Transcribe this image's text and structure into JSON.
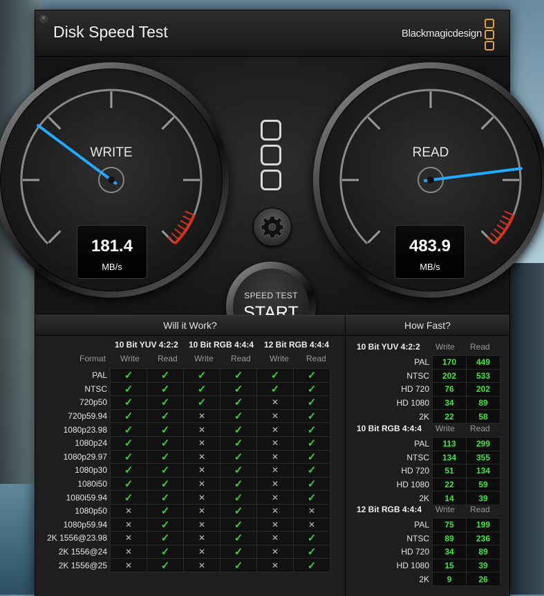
{
  "window": {
    "title": "Disk Speed Test",
    "brand": "Blackmagicdesign",
    "close_glyph": "×"
  },
  "gauges": {
    "write": {
      "label": "WRITE",
      "value": "181.4",
      "unit": "MB/s"
    },
    "read": {
      "label": "READ",
      "value": "483.9",
      "unit": "MB/s"
    }
  },
  "start_button": {
    "sub_label": "SPEED TEST",
    "label": "START"
  },
  "will_it_work": {
    "title": "Will it Work?",
    "format_header": "Format",
    "groups": [
      "10 Bit YUV 4:2:2",
      "10 Bit RGB 4:4:4",
      "12 Bit RGB 4:4:4"
    ],
    "sub_headers": [
      "Write",
      "Read",
      "Write",
      "Read",
      "Write",
      "Read"
    ],
    "rows": [
      {
        "format": "PAL",
        "cells": [
          1,
          1,
          1,
          1,
          1,
          1
        ]
      },
      {
        "format": "NTSC",
        "cells": [
          1,
          1,
          1,
          1,
          1,
          1
        ]
      },
      {
        "format": "720p50",
        "cells": [
          1,
          1,
          1,
          1,
          0,
          1
        ]
      },
      {
        "format": "720p59.94",
        "cells": [
          1,
          1,
          0,
          1,
          0,
          1
        ]
      },
      {
        "format": "1080p23.98",
        "cells": [
          1,
          1,
          0,
          1,
          0,
          1
        ]
      },
      {
        "format": "1080p24",
        "cells": [
          1,
          1,
          0,
          1,
          0,
          1
        ]
      },
      {
        "format": "1080p29.97",
        "cells": [
          1,
          1,
          0,
          1,
          0,
          1
        ]
      },
      {
        "format": "1080p30",
        "cells": [
          1,
          1,
          0,
          1,
          0,
          1
        ]
      },
      {
        "format": "1080i50",
        "cells": [
          1,
          1,
          0,
          1,
          0,
          1
        ]
      },
      {
        "format": "1080i59.94",
        "cells": [
          1,
          1,
          0,
          1,
          0,
          1
        ]
      },
      {
        "format": "1080p50",
        "cells": [
          0,
          1,
          0,
          1,
          0,
          0
        ]
      },
      {
        "format": "1080p59.94",
        "cells": [
          0,
          1,
          0,
          1,
          0,
          0
        ]
      },
      {
        "format": "2K 1556@23.98",
        "cells": [
          0,
          1,
          0,
          1,
          0,
          1
        ]
      },
      {
        "format": "2K 1556@24",
        "cells": [
          0,
          1,
          0,
          1,
          0,
          1
        ]
      },
      {
        "format": "2K 1556@25",
        "cells": [
          0,
          1,
          0,
          1,
          0,
          1
        ]
      }
    ]
  },
  "how_fast": {
    "title": "How Fast?",
    "write_header": "Write",
    "read_header": "Read",
    "sections": [
      {
        "name": "10 Bit YUV 4:2:2",
        "rows": [
          {
            "format": "PAL",
            "write": "170",
            "read": "449"
          },
          {
            "format": "NTSC",
            "write": "202",
            "read": "533"
          },
          {
            "format": "HD 720",
            "write": "76",
            "read": "202"
          },
          {
            "format": "HD 1080",
            "write": "34",
            "read": "89"
          },
          {
            "format": "2K",
            "write": "22",
            "read": "58"
          }
        ]
      },
      {
        "name": "10 Bit RGB 4:4:4",
        "rows": [
          {
            "format": "PAL",
            "write": "113",
            "read": "299"
          },
          {
            "format": "NTSC",
            "write": "134",
            "read": "355"
          },
          {
            "format": "HD 720",
            "write": "51",
            "read": "134"
          },
          {
            "format": "HD 1080",
            "write": "22",
            "read": "59"
          },
          {
            "format": "2K",
            "write": "14",
            "read": "39"
          }
        ]
      },
      {
        "name": "12 Bit RGB 4:4:4",
        "rows": [
          {
            "format": "PAL",
            "write": "75",
            "read": "199"
          },
          {
            "format": "NTSC",
            "write": "89",
            "read": "236"
          },
          {
            "format": "HD 720",
            "write": "34",
            "read": "89"
          },
          {
            "format": "HD 1080",
            "write": "15",
            "read": "39"
          },
          {
            "format": "2K",
            "write": "9",
            "read": "26"
          }
        ]
      }
    ]
  },
  "colors": {
    "needle": "#1fa9ff",
    "redzone": "#d8321e",
    "ok": "#36d236",
    "number": "#3ee63e",
    "brand_orange": "#e6a22c"
  },
  "icons": {
    "check": "✓",
    "cross": "✕",
    "gear": "gear-icon"
  }
}
